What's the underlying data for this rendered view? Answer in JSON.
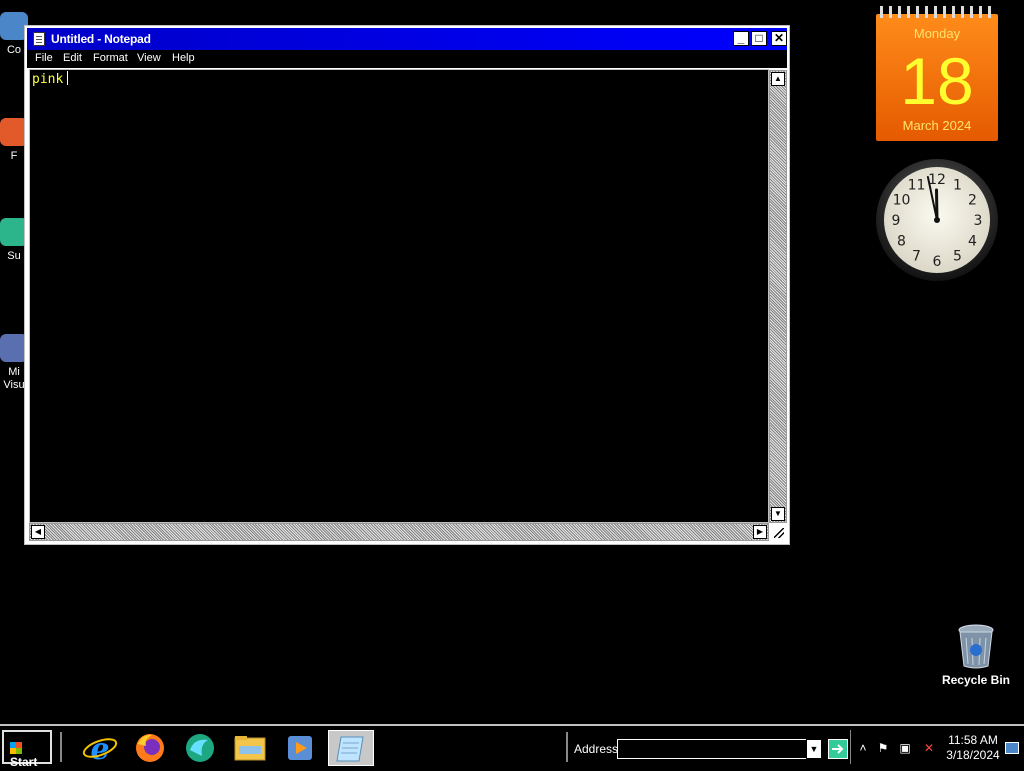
{
  "desktop": {
    "icons": [
      {
        "label": "Co",
        "icon": "computer-icon"
      },
      {
        "label": "F",
        "icon": "app-icon"
      },
      {
        "label": "Su",
        "icon": "app-icon"
      },
      {
        "label": "Mi\nVisu",
        "icon": "app-icon"
      }
    ],
    "recycle_bin": {
      "label": "Recycle Bin",
      "icon": "recycle-bin-icon"
    }
  },
  "notepad": {
    "title": "Untitled - Notepad",
    "menu": [
      "File",
      "Edit",
      "Format",
      "View",
      "Help"
    ],
    "content": "pink",
    "text_color": "#ffff40",
    "background": "#000000",
    "titlebar_color": "#0000ff"
  },
  "calendar_gadget": {
    "weekday": "Monday",
    "day": "18",
    "month_year": "March 2024",
    "color": "#ff8c1a"
  },
  "clock_gadget": {
    "numbers": [
      "12",
      "1",
      "2",
      "3",
      "4",
      "5",
      "6",
      "7",
      "8",
      "9",
      "10",
      "11"
    ],
    "time_hour": 11,
    "time_minute": 58,
    "icon": "analog-clock-icon"
  },
  "taskbar": {
    "start_label": "Start",
    "pinned": [
      {
        "name": "internet-explorer-icon"
      },
      {
        "name": "firefox-icon"
      },
      {
        "name": "browser-icon"
      },
      {
        "name": "file-explorer-icon"
      },
      {
        "name": "media-player-icon"
      },
      {
        "name": "notepad-icon"
      }
    ],
    "address_label": "Address",
    "address_value": "",
    "tray": {
      "time": "11:58 AM",
      "date": "3/18/2024",
      "icons": [
        "chevron-up-icon",
        "flag-icon",
        "network-icon",
        "speaker-muted-icon",
        "show-desktop-icon"
      ]
    }
  }
}
